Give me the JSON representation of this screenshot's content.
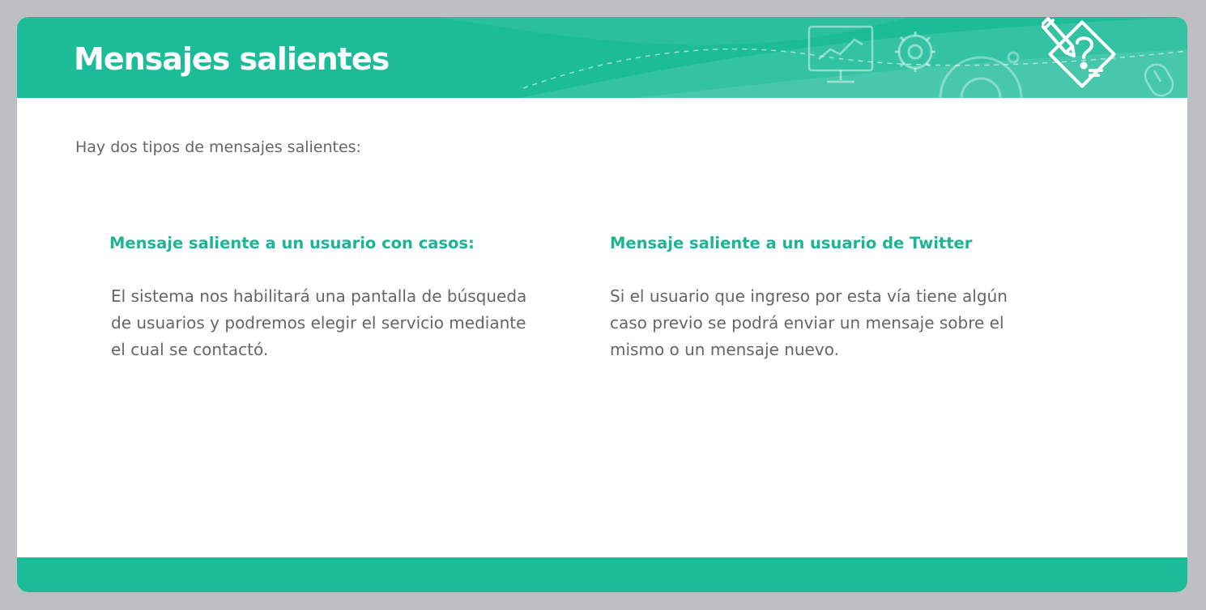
{
  "slide": {
    "title": "Mensajes salientes",
    "intro": "Hay dos tipos de mensajes salientes:",
    "columns": [
      {
        "heading": "Mensaje saliente a un usuario con casos:",
        "body": "El sistema nos habilitará una pantalla de búsqueda de usuarios y podremos elegir el servicio mediante el cual se contactó."
      },
      {
        "heading": "Mensaje saliente a un usuario de Twitter",
        "body": "Si el usuario que ingreso por esta vía tiene algún caso previo se podrá enviar un mensaje sobre el mismo o un mensaje nuevo."
      }
    ]
  },
  "icons": [
    "monitor-chart-icon",
    "gear-icon",
    "large-gear-icon",
    "computer-mouse-icon",
    "pencil-question-badge-icon"
  ],
  "colors": {
    "accent": "#1cbc99",
    "heading": "#1cb594",
    "body_text": "#666666",
    "background": "#bcbfc3",
    "card": "#ffffff"
  }
}
